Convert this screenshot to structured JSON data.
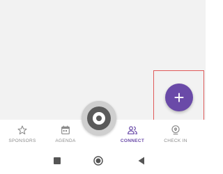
{
  "fab": {
    "label": "+"
  },
  "bottom_nav": {
    "items": [
      {
        "label": "SPONSORS",
        "icon": "star-icon",
        "active": false
      },
      {
        "label": "AGENDA",
        "icon": "calendar-icon",
        "active": false
      },
      {
        "label": "CONNECT",
        "icon": "people-icon",
        "active": true
      },
      {
        "label": "CHECK IN",
        "icon": "location-pin-icon",
        "active": false
      }
    ]
  },
  "system_nav": {
    "buttons": [
      "recents-icon",
      "home-icon",
      "back-icon"
    ]
  },
  "colors": {
    "accent": "#6a4aa8",
    "inactive": "#8a8a8a",
    "highlight": "#e05a5a"
  }
}
